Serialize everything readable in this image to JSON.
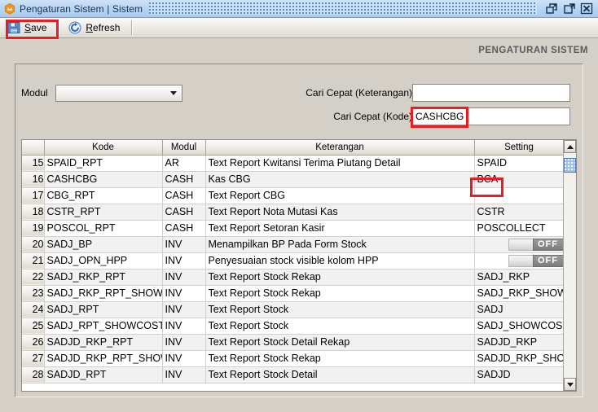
{
  "window": {
    "title": "Pengaturan Sistem | Sistem",
    "app_icon": "hexagon-app-icon",
    "controls": [
      {
        "name": "restore-button",
        "icon": "restore-down-icon"
      },
      {
        "name": "maximize-button",
        "icon": "maximize-icon"
      },
      {
        "name": "close-button",
        "icon": "close-icon"
      }
    ]
  },
  "toolbar": {
    "save": {
      "label": "Save",
      "accel": "S",
      "icon": "save-floppy-icon"
    },
    "refresh": {
      "label": "Refresh",
      "accel": "R",
      "icon": "refresh-circular-arrows-icon"
    }
  },
  "page": {
    "heading": "PENGATURAN SISTEM"
  },
  "form": {
    "modul_label": "Modul",
    "modul_value": "",
    "modul_placeholder": "",
    "cari_keterangan_label": "Cari Cepat (Keterangan)",
    "cari_keterangan_value": "",
    "cari_kode_label": "Cari Cepat (Kode)",
    "cari_kode_value": "CASHCBG"
  },
  "grid": {
    "columns": [
      "",
      "Kode",
      "Modul",
      "Keterangan",
      "Setting"
    ],
    "rows": [
      {
        "num": "15",
        "kode": "SPAID_RPT",
        "modul": "AR",
        "keterangan": "Text Report Kwitansi Terima Piutang Detail",
        "setting": "SPAID",
        "type": "text"
      },
      {
        "num": "16",
        "kode": "CASHCBG",
        "modul": "CASH",
        "keterangan": "Kas CBG",
        "setting": "BCA",
        "type": "text"
      },
      {
        "num": "17",
        "kode": "CBG_RPT",
        "modul": "CASH",
        "keterangan": "Text Report CBG",
        "setting": "",
        "type": "text"
      },
      {
        "num": "18",
        "kode": "CSTR_RPT",
        "modul": "CASH",
        "keterangan": "Text Report Nota Mutasi Kas",
        "setting": "CSTR",
        "type": "text"
      },
      {
        "num": "19",
        "kode": "POSCOL_RPT",
        "modul": "CASH",
        "keterangan": "Text Report Setoran Kasir",
        "setting": "POSCOLLECT",
        "type": "text"
      },
      {
        "num": "20",
        "kode": "SADJ_BP",
        "modul": "INV",
        "keterangan": "Menampilkan BP Pada Form Stock",
        "setting": "OFF",
        "type": "toggle"
      },
      {
        "num": "21",
        "kode": "SADJ_OPN_HPP",
        "modul": "INV",
        "keterangan": "Penyesuaian stock visible kolom HPP",
        "setting": "OFF",
        "type": "toggle"
      },
      {
        "num": "22",
        "kode": "SADJ_RKP_RPT",
        "modul": "INV",
        "keterangan": "Text Report Stock Rekap",
        "setting": "SADJ_RKP",
        "type": "text"
      },
      {
        "num": "23",
        "kode": "SADJ_RKP_RPT_SHOW",
        "modul": "INV",
        "keterangan": "Text Report Stock Rekap",
        "setting": "SADJ_RKP_SHOW",
        "type": "text"
      },
      {
        "num": "24",
        "kode": "SADJ_RPT",
        "modul": "INV",
        "keterangan": "Text Report Stock",
        "setting": "SADJ",
        "type": "text"
      },
      {
        "num": "25",
        "kode": "SADJ_RPT_SHOWCOST",
        "modul": "INV",
        "keterangan": "Text Report Stock",
        "setting": "SADJ_SHOWCOST",
        "type": "text"
      },
      {
        "num": "26",
        "kode": "SADJD_RKP_RPT",
        "modul": "INV",
        "keterangan": "Text Report Stock Detail Rekap",
        "setting": "SADJD_RKP",
        "type": "text"
      },
      {
        "num": "27",
        "kode": "SADJD_RKP_RPT_SHOW",
        "modul": "INV",
        "keterangan": "Text Report Stock Rekap",
        "setting": "SADJD_RKP_SHOW",
        "type": "text"
      },
      {
        "num": "28",
        "kode": "SADJD_RPT",
        "modul": "INV",
        "keterangan": "Text Report Stock Detail",
        "setting": "SADJD",
        "type": "text"
      }
    ]
  },
  "scrollbar": {
    "up_icon": "scroll-up-arrow-icon",
    "down_icon": "scroll-down-arrow-icon"
  },
  "annotations": {
    "color": "#ec1c24",
    "boxes": [
      "save-button-highlight",
      "cari-kode-value-highlight",
      "setting-bca-highlight"
    ]
  }
}
